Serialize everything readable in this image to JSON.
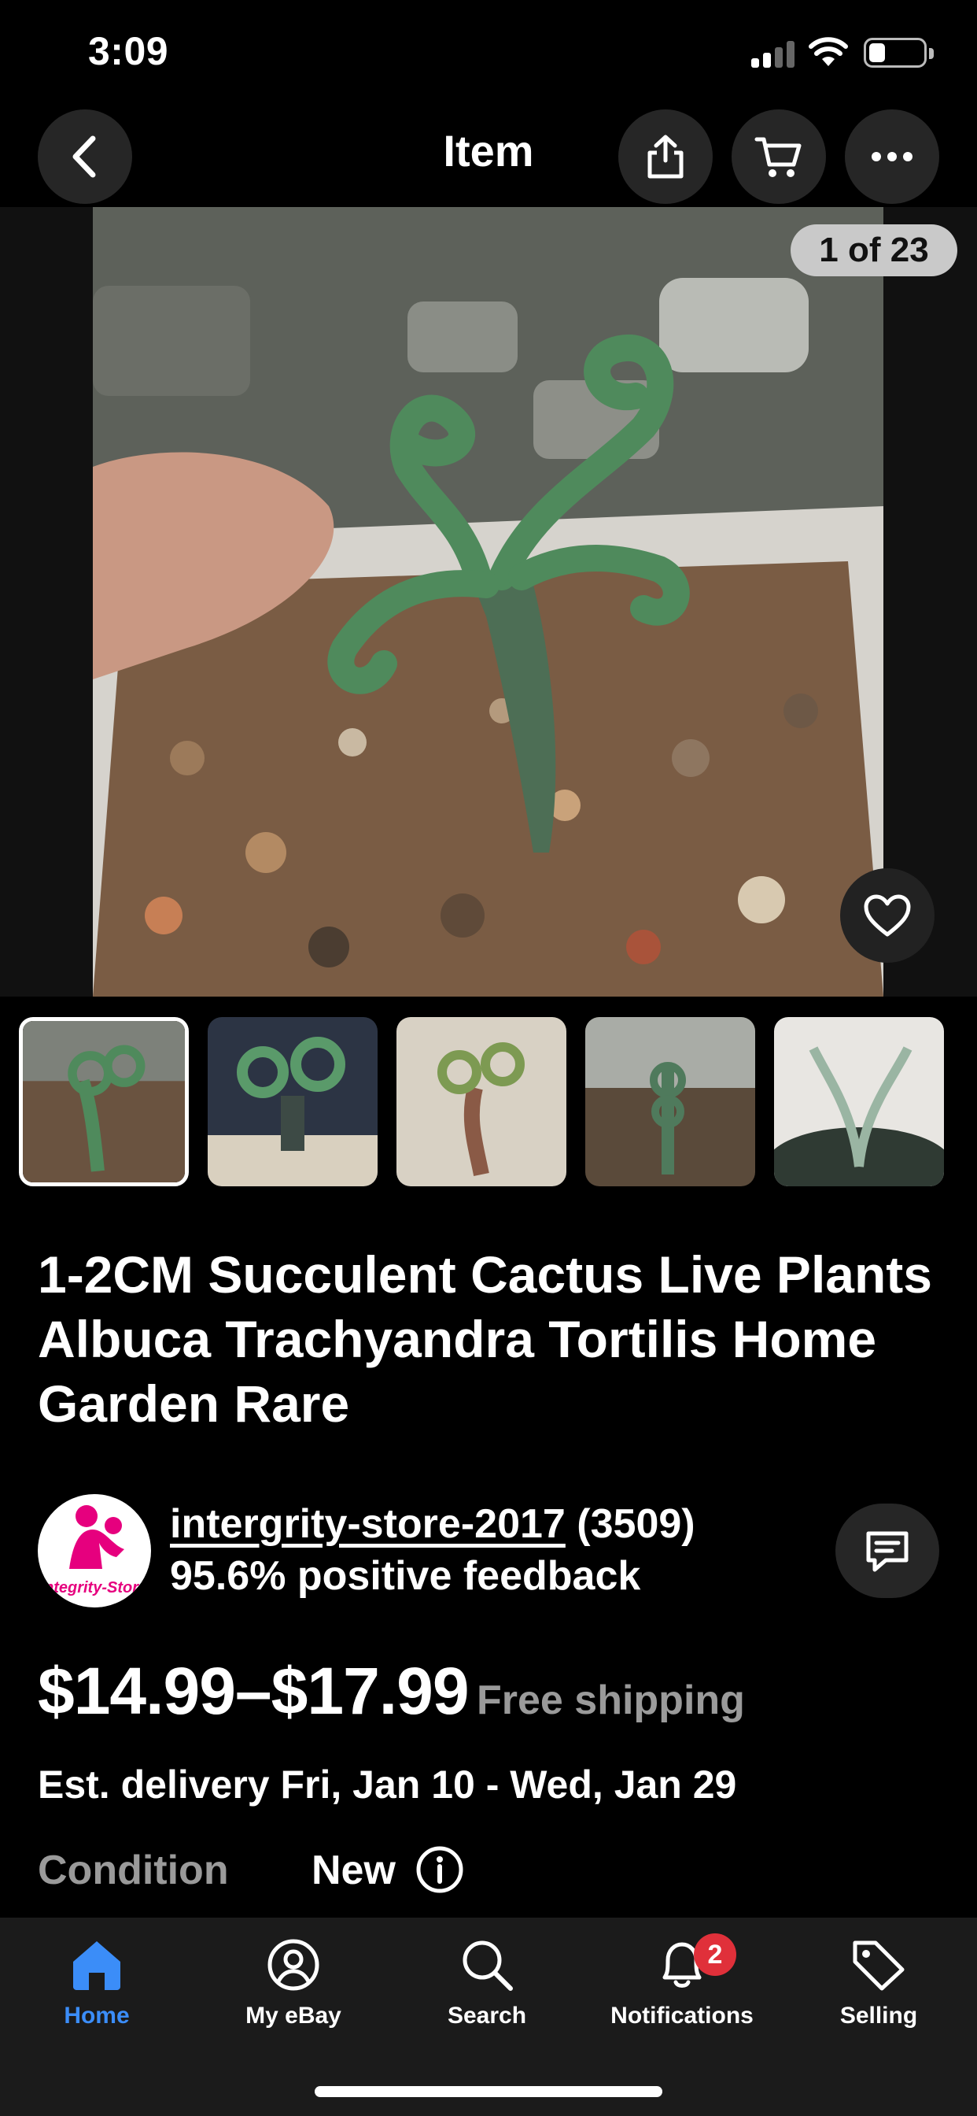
{
  "status_bar": {
    "time": "3:09"
  },
  "header": {
    "title": "Item"
  },
  "gallery": {
    "counter": "1 of 23"
  },
  "item": {
    "title": "1-2CM Succulent Cactus Live Plants Albuca Trachyandra Tortilis Home Garden Rare"
  },
  "seller": {
    "name": "intergrity-store-2017",
    "rating_count": "(3509)",
    "feedback": "95.6% positive feedback",
    "logo_text": "ntegrity-Stor"
  },
  "pricing": {
    "price": "$14.99–$17.99",
    "shipping": "Free shipping",
    "delivery": "Est. delivery Fri, Jan 10 - Wed, Jan 29"
  },
  "condition": {
    "label": "Condition",
    "value": "New"
  },
  "tabbar": {
    "tabs": [
      {
        "label": "Home",
        "icon": "home-icon",
        "active": true
      },
      {
        "label": "My eBay",
        "icon": "profile-icon"
      },
      {
        "label": "Search",
        "icon": "search-icon"
      },
      {
        "label": "Notifications",
        "icon": "bell-icon",
        "badge": "2"
      },
      {
        "label": "Selling",
        "icon": "tag-icon"
      }
    ]
  },
  "colors": {
    "accent": "#3b8df8",
    "badge": "#e0303a",
    "muted": "#9a9a9a",
    "seller_brand": "#e6007e"
  }
}
